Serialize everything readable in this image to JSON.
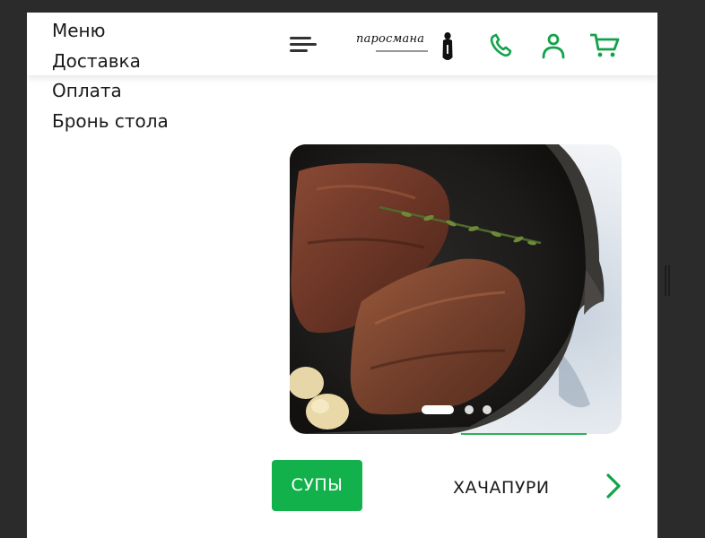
{
  "menu": {
    "items": [
      {
        "label": "Меню"
      },
      {
        "label": "Доставка"
      },
      {
        "label": "Оплата"
      },
      {
        "label": "Бронь стола"
      }
    ]
  },
  "header": {
    "logo_text": "паросмана",
    "icons": [
      "burger-menu-icon",
      "phone-icon",
      "user-icon",
      "cart-icon"
    ],
    "accent_color": "#12a34a"
  },
  "carousel": {
    "slides_count": 3,
    "active_slide": 1
  },
  "categories": {
    "active_label": "СУПЫ",
    "next_label": "ХАЧАПУРИ",
    "active_color": "#12b14b"
  }
}
